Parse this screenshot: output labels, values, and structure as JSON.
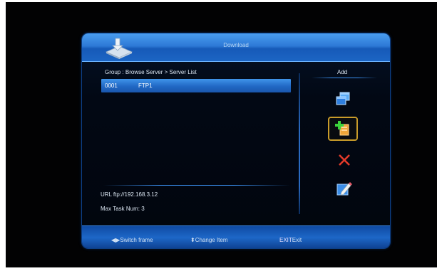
{
  "window": {
    "title": "Download"
  },
  "breadcrumb": "Group : Browse Server > Server List",
  "server_list": [
    {
      "number": "0001",
      "name": "FTP1",
      "selected": true
    }
  ],
  "info": {
    "url": "URL ftp://192.168.3.12",
    "max_task": "Max Task Num: 3"
  },
  "sidebar": {
    "title": "Add",
    "actions": [
      {
        "name": "new-window",
        "icon": "windows-icon"
      },
      {
        "name": "add",
        "icon": "add-folder-icon",
        "selected": true
      },
      {
        "name": "delete",
        "icon": "delete-x-icon"
      },
      {
        "name": "edit",
        "icon": "edit-pencil-icon"
      }
    ]
  },
  "footer": {
    "switch_frame": "Switch frame",
    "change_item": "Change Item",
    "exit_key": "EXIT",
    "exit_label": "Exit"
  },
  "colors": {
    "accent": "#2a78d8",
    "highlight_border": "#c89b2a",
    "delete": "#e23a2a"
  }
}
